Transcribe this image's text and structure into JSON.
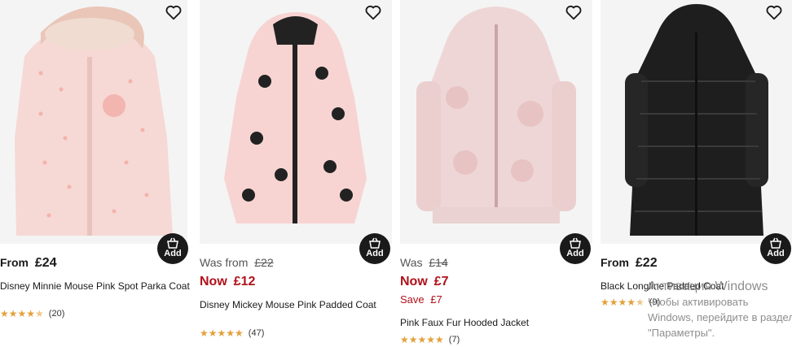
{
  "products": [
    {
      "id": "disney-minnie-parka",
      "price_prefix": "From",
      "price": "£24",
      "title": "Disney Minnie Mouse Pink Spot Parka Coat",
      "rating": 4.5,
      "reviews": "(20)",
      "add_label": "Add"
    },
    {
      "id": "disney-mickey-padded",
      "was_prefix": "Was from",
      "was_price": "£22",
      "now_prefix": "Now",
      "now_price": "£12",
      "title": "Disney Mickey Mouse Pink Padded Coat",
      "rating": 5,
      "reviews": "(47)",
      "add_label": "Add"
    },
    {
      "id": "pink-faux-fur",
      "was_prefix": "Was",
      "was_price": "£14",
      "now_prefix": "Now",
      "now_price": "£7",
      "save_prefix": "Save",
      "save_amount": "£7",
      "title": "Pink Faux Fur Hooded Jacket",
      "rating": 5,
      "reviews": "(7)",
      "add_label": "Add"
    },
    {
      "id": "black-longline-padded",
      "price_prefix": "From",
      "price": "£22",
      "title": "Black Longline Padded Coat",
      "rating": 4.5,
      "reviews": "(9)",
      "add_label": "Add"
    }
  ],
  "overlay": {
    "line1": "Активация Windows",
    "line2": "Чтобы активировать Windows, перейдите в раздел \"Параметры\"."
  },
  "colors": {
    "sale_red": "#b0111b",
    "star": "#e3a13b",
    "add_button": "#1a1a1a"
  }
}
